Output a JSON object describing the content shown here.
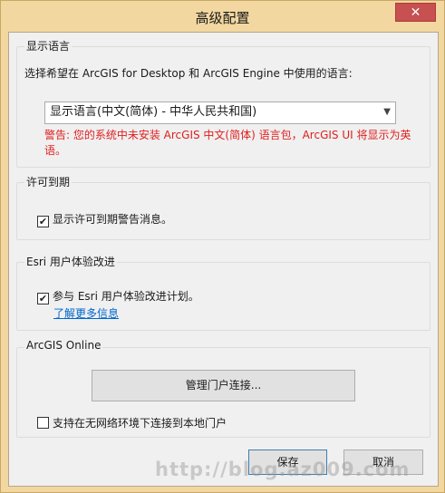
{
  "window": {
    "title": "高级配置",
    "close_glyph": "✕"
  },
  "display_language": {
    "group_title": "显示语言",
    "prompt": "选择希望在 ArcGIS for Desktop 和 ArcGIS Engine 中使用的语言:",
    "selected": "显示语言(中文(简体) - 中华人民共和国)",
    "warning": "警告: 您的系统中未安装 ArcGIS 中文(简体) 语言包，ArcGIS UI 将显示为英语。"
  },
  "license_expiration": {
    "group_title": "许可到期",
    "checkbox_label": "显示许可到期警告消息。",
    "checked": true
  },
  "esri_ux": {
    "group_title": "Esri 用户体验改进",
    "checkbox_label": "参与 Esri 用户体验改进计划。",
    "checked": true,
    "learn_more": "了解更多信息"
  },
  "arcgis_online": {
    "group_title": "ArcGIS Online",
    "manage_button": "管理门户连接...",
    "offline_checkbox_label": "支持在无网络环境下连接到本地门户",
    "offline_checked": false
  },
  "footer": {
    "save_label": "保存",
    "cancel_label": "取消"
  },
  "watermark": "http://blog.az009.com",
  "colors": {
    "window_frame": "#f2d8a0",
    "close_button": "#c75050",
    "warning_text": "#e01e1e",
    "link_text": "#0066cc"
  }
}
